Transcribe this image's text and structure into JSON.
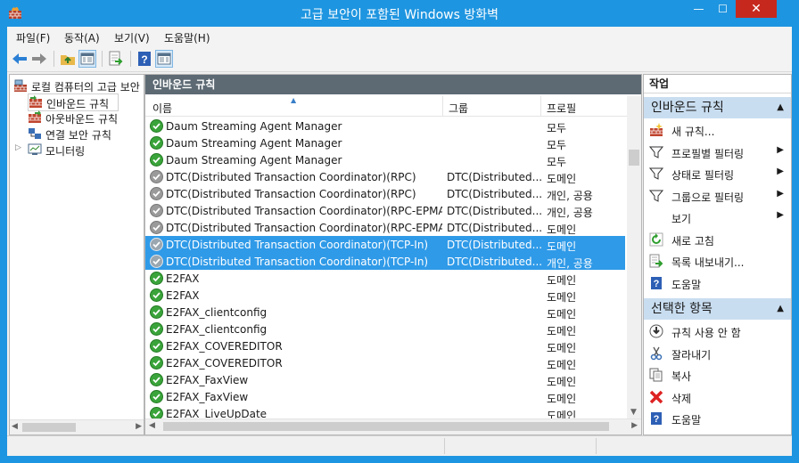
{
  "window": {
    "title": "고급 보안이 포함된 Windows 방화벽",
    "min_symbol": "—",
    "max_symbol": "☐",
    "close_symbol": "✕",
    "accent": "#1e95e0"
  },
  "menu": [
    "파일(F)",
    "동작(A)",
    "보기(V)",
    "도움말(H)"
  ],
  "toolbar": {
    "icons": [
      "back-arrow-icon",
      "forward-arrow-icon",
      "up-folder-icon",
      "show-hide-tree-icon",
      "export-list-icon",
      "help-icon",
      "show-hide-action-pane-icon"
    ]
  },
  "tree": {
    "root": "로컬 컴퓨터의 고급 보안",
    "items": [
      "인바운드 규칙",
      "아웃바운드 규칙",
      "연결 보안 규칙",
      "모니터링"
    ]
  },
  "center": {
    "header": "인바운드 규칙",
    "columns": [
      "이름",
      "그룹",
      "프로필"
    ],
    "rows": [
      {
        "name": "Daum Streaming Agent Manager",
        "group": "",
        "profile": "모두",
        "state": "enabled",
        "selected": false
      },
      {
        "name": "Daum Streaming Agent Manager",
        "group": "",
        "profile": "모두",
        "state": "enabled",
        "selected": false
      },
      {
        "name": "Daum Streaming Agent Manager",
        "group": "",
        "profile": "모두",
        "state": "enabled",
        "selected": false
      },
      {
        "name": "DTC(Distributed Transaction Coordinator)(RPC)",
        "group": "DTC(Distributed...",
        "profile": "도메인",
        "state": "disabled",
        "selected": false
      },
      {
        "name": "DTC(Distributed Transaction Coordinator)(RPC)",
        "group": "DTC(Distributed...",
        "profile": "개인, 공용",
        "state": "disabled",
        "selected": false
      },
      {
        "name": "DTC(Distributed Transaction Coordinator)(RPC-EPMAP)",
        "group": "DTC(Distributed...",
        "profile": "개인, 공용",
        "state": "disabled",
        "selected": false
      },
      {
        "name": "DTC(Distributed Transaction Coordinator)(RPC-EPMAP)",
        "group": "DTC(Distributed...",
        "profile": "도메인",
        "state": "disabled",
        "selected": false
      },
      {
        "name": "DTC(Distributed Transaction Coordinator)(TCP-In)",
        "group": "DTC(Distributed...",
        "profile": "도메인",
        "state": "disabled",
        "selected": true
      },
      {
        "name": "DTC(Distributed Transaction Coordinator)(TCP-In)",
        "group": "DTC(Distributed...",
        "profile": "개인, 공용",
        "state": "disabled",
        "selected": true
      },
      {
        "name": "E2FAX",
        "group": "",
        "profile": "도메인",
        "state": "enabled",
        "selected": false
      },
      {
        "name": "E2FAX",
        "group": "",
        "profile": "도메인",
        "state": "enabled",
        "selected": false
      },
      {
        "name": "E2FAX_clientconfig",
        "group": "",
        "profile": "도메인",
        "state": "enabled",
        "selected": false
      },
      {
        "name": "E2FAX_clientconfig",
        "group": "",
        "profile": "도메인",
        "state": "enabled",
        "selected": false
      },
      {
        "name": "E2FAX_COVEREDITOR",
        "group": "",
        "profile": "도메인",
        "state": "enabled",
        "selected": false
      },
      {
        "name": "E2FAX_COVEREDITOR",
        "group": "",
        "profile": "도메인",
        "state": "enabled",
        "selected": false
      },
      {
        "name": "E2FAX_FaxView",
        "group": "",
        "profile": "도메인",
        "state": "enabled",
        "selected": false
      },
      {
        "name": "E2FAX_FaxView",
        "group": "",
        "profile": "도메인",
        "state": "enabled",
        "selected": false
      },
      {
        "name": "E2FAX_LiveUpDate",
        "group": "",
        "profile": "도메인",
        "state": "enabled",
        "selected": false
      }
    ]
  },
  "actions": {
    "title": "작업",
    "section1": {
      "label": "인바운드 규칙",
      "items": [
        {
          "label": "새 규칙...",
          "icon": "new-rule-icon",
          "submenu": false
        },
        {
          "label": "프로필별 필터링",
          "icon": "filter-icon",
          "submenu": true
        },
        {
          "label": "상태로 필터링",
          "icon": "filter-icon",
          "submenu": true
        },
        {
          "label": "그룹으로 필터링",
          "icon": "filter-icon",
          "submenu": true
        },
        {
          "label": "보기",
          "icon": "",
          "submenu": true
        },
        {
          "label": "새로 고침",
          "icon": "refresh-icon",
          "submenu": false
        },
        {
          "label": "목록 내보내기...",
          "icon": "export-list-icon",
          "submenu": false
        },
        {
          "label": "도움말",
          "icon": "help-icon",
          "submenu": false
        }
      ]
    },
    "section2": {
      "label": "선택한 항목",
      "items": [
        {
          "label": "규칙 사용 안 함",
          "icon": "disable-rule-icon",
          "submenu": false
        },
        {
          "label": "잘라내기",
          "icon": "cut-icon",
          "submenu": false
        },
        {
          "label": "복사",
          "icon": "copy-icon",
          "submenu": false
        },
        {
          "label": "삭제",
          "icon": "delete-icon",
          "submenu": false
        },
        {
          "label": "도움말",
          "icon": "help-icon",
          "submenu": false
        }
      ]
    }
  }
}
